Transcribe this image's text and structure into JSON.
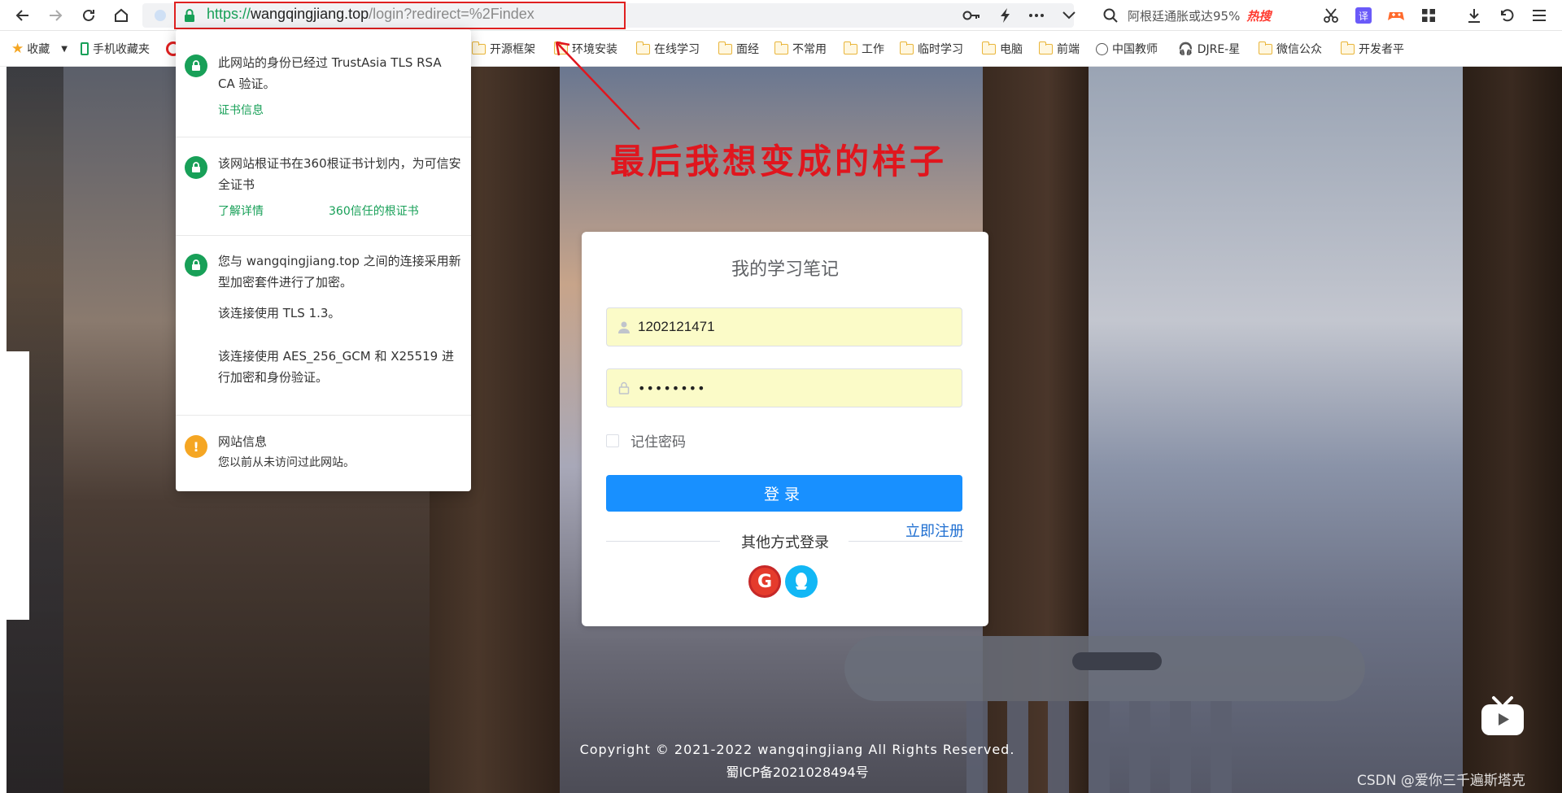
{
  "browser": {
    "url": {
      "protocol": "https://",
      "host": "wangqingjiang.top",
      "path": "/login?redirect=%2Findex"
    },
    "search": {
      "text": "阿根廷通胀或达95%",
      "hot_tag": "热搜"
    },
    "bookmarks": [
      {
        "label": "收藏",
        "icon": "star-icon"
      },
      {
        "label": "手机收藏夹",
        "icon": "phone-icon"
      },
      {
        "label": "开源框架",
        "icon": "folder-icon"
      },
      {
        "label": "环境安装",
        "icon": "folder-icon"
      },
      {
        "label": "在线学习",
        "icon": "folder-icon"
      },
      {
        "label": "面经",
        "icon": "folder-icon"
      },
      {
        "label": "不常用",
        "icon": "folder-icon"
      },
      {
        "label": "工作",
        "icon": "folder-icon"
      },
      {
        "label": "临时学习",
        "icon": "folder-icon"
      },
      {
        "label": "电脑",
        "icon": "folder-icon"
      },
      {
        "label": "前端",
        "icon": "folder-icon"
      },
      {
        "label": "中国教师",
        "icon": "globe-icon"
      },
      {
        "label": "DJRE-星",
        "icon": "headphones-icon"
      },
      {
        "label": "微信公众",
        "icon": "folder-icon"
      },
      {
        "label": "开发者平",
        "icon": "folder-icon"
      }
    ]
  },
  "security_popup": {
    "identity": {
      "text": "此网站的身份已经过 TrustAsia TLS RSA CA 验证。",
      "link": "证书信息"
    },
    "root_cert": {
      "text": "该网站根证书在360根证书计划内，为可信安全证书",
      "link_details": "了解详情",
      "link_root": "360信任的根证书"
    },
    "connection": {
      "text": "您与 wangqingjiang.top 之间的连接采用新型加密套件进行了加密。",
      "tls": "该连接使用 TLS 1.3。",
      "cipher": "该连接使用 AES_256_GCM 和 X25519 进行加密和身份验证。"
    },
    "site_info": {
      "title": "网站信息",
      "text": "您以前从未访问过此网站。"
    }
  },
  "annotation": {
    "text": "最后我想变成的样子"
  },
  "login": {
    "title": "我的学习笔记",
    "username_value": "1202121471",
    "password_value": "••••••••",
    "remember_label": "记住密码",
    "login_button": "登录",
    "register_link": "立即注册",
    "other_login": "其他方式登录"
  },
  "footer": {
    "copyright": "Copyright © 2021-2022 wangqingjiang All Rights Reserved.",
    "icp": "蜀ICP备2021028494号"
  },
  "watermark": "CSDN @爱你三千遍斯塔克",
  "colors": {
    "accent_blue": "#1890ff",
    "secure_green": "#18a058",
    "annotation_red": "#e02020",
    "autofill_yellow": "#fbfbc8"
  }
}
